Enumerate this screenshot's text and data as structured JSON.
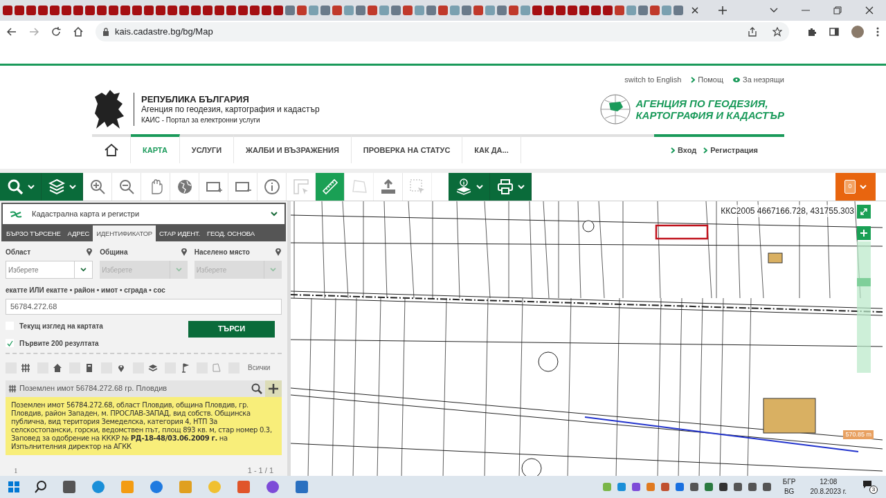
{
  "browser": {
    "url": "kais.cadastre.bg/bg/Map"
  },
  "header": {
    "top_links": [
      {
        "kind": "plain",
        "label": "switch to English"
      },
      {
        "kind": "chevron",
        "label": "Помощ"
      },
      {
        "kind": "eye",
        "label": "За незрящи"
      }
    ],
    "title": "РЕПУБЛИКА БЪЛГАРИЯ",
    "subtitle": "Агенция по геодезия, картография и кадастър",
    "portal": "КАИС - Портал за електронни услуги",
    "agency_name": [
      "АГЕНЦИЯ ПО ГЕОДЕЗИЯ,",
      "КАРТОГРАФИЯ И КАДАСТЪР"
    ]
  },
  "nav": [
    {
      "label": "КАРТА",
      "selected": true
    },
    {
      "label": "УСЛУГИ",
      "selected": false
    },
    {
      "label": "ЖАЛБИ И ВЪЗРАЖЕНИЯ",
      "selected": false
    },
    {
      "label": "ПРОВЕРКА НА СТАТУС",
      "selected": false
    },
    {
      "label": "КАК ДА...",
      "selected": false
    }
  ],
  "auth_links": [
    "Вход",
    "Регистрация"
  ],
  "toolbar": [
    {
      "kind": "search",
      "dropdown": true,
      "selected": false,
      "disabled": false
    },
    {
      "kind": "layers",
      "dropdown": true,
      "selected": false,
      "disabled": false
    },
    {
      "kind": "zoom-in",
      "dropdown": false,
      "selected": false,
      "disabled": false
    },
    {
      "kind": "zoom-out",
      "dropdown": false,
      "selected": false,
      "disabled": false
    },
    {
      "kind": "hand",
      "dropdown": false,
      "selected": false,
      "disabled": false
    },
    {
      "kind": "globe",
      "dropdown": false,
      "selected": false,
      "disabled": false
    },
    {
      "kind": "rect-plus",
      "dropdown": false,
      "selected": false,
      "disabled": false
    },
    {
      "kind": "rect-minus",
      "dropdown": false,
      "selected": false,
      "disabled": false
    },
    {
      "kind": "info",
      "dropdown": false,
      "selected": false,
      "disabled": false
    },
    {
      "kind": "angle",
      "dropdown": false,
      "selected": false,
      "disabled": true
    },
    {
      "kind": "ruler",
      "dropdown": false,
      "selected": true,
      "disabled": false
    },
    {
      "kind": "polygon",
      "dropdown": false,
      "selected": false,
      "disabled": true
    },
    {
      "kind": "upload",
      "dropdown": false,
      "selected": false,
      "disabled": false
    },
    {
      "kind": "select",
      "dropdown": false,
      "selected": false,
      "disabled": true
    },
    {
      "kind": "info-layers",
      "dropdown": true,
      "selected": false,
      "disabled": false
    },
    {
      "kind": "print",
      "dropdown": true,
      "selected": false,
      "disabled": false
    }
  ],
  "cart": {
    "count": "0"
  },
  "panel": {
    "layer_select": "Кадастрална карта и регистри",
    "tabs": [
      {
        "label": "БЪРЗО ТЪРСЕНЕ",
        "selected": false
      },
      {
        "label": "АДРЕС",
        "selected": false
      },
      {
        "label": "ИДЕНТИФИКАТОР",
        "selected": true
      },
      {
        "label": "СТАР ИДЕНТ.",
        "selected": false
      },
      {
        "label": "ГЕОД. ОСНОВА",
        "selected": false
      }
    ],
    "selects": [
      {
        "label": "Област",
        "placeholder": "Изберете",
        "disabled": false
      },
      {
        "label": "Община",
        "placeholder": "Изберете",
        "disabled": true
      },
      {
        "label": "Населено място",
        "placeholder": "Изберете",
        "disabled": true
      }
    ],
    "id_label": "екатте ИЛИ екатте • район • имот • сграда • сос",
    "id_value": "56784.272.68",
    "checkboxes": [
      {
        "label": "Текущ изглед на картата",
        "checked": false
      },
      {
        "label": "Първите 200 резултата",
        "checked": true
      }
    ],
    "search_button": "ТЪРСИ",
    "filters": [
      {
        "kind": "grid"
      },
      {
        "kind": "home"
      },
      {
        "kind": "building"
      },
      {
        "kind": "pin"
      },
      {
        "kind": "layers"
      },
      {
        "kind": "flag"
      },
      {
        "kind": "polygon"
      }
    ],
    "filter_all": "Всички",
    "result": {
      "title": "Поземлен имот 56784.272.68 гр. Пловдив",
      "lines": [
        "Поземлен имот 56784.272.68, област Пловдив, община Пловдив, гр. Пловдив, район Западен, м. ПРОСЛАВ-ЗАПАД, вид собств. Общинска публична, вид територия Земеделска, категория 4, НТП За селскостопански, горски, ведомствен път, площ 893 кв. м, стар номер 0.3,",
        "Заповед за одобрение на КККР № **РД-18-48/03.06.2009 г.** на Изпълнителния директор на АГКК"
      ]
    },
    "pager": {
      "page": "1",
      "range": "1 - 1 / 1"
    }
  },
  "map": {
    "coordinates": "ККС2005 4667166.728, 431755.303",
    "scale": "570.85 m",
    "zoom": {
      "level": 0.7
    }
  },
  "taskbar": {
    "language": "БГР",
    "layout": "BG",
    "time": "12:08",
    "date": "20.8.2023 г.",
    "notifications": "3"
  }
}
